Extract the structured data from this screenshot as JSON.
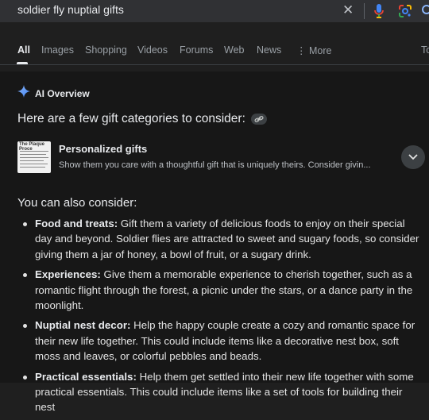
{
  "search": {
    "query": "soldier fly nuptial gifts",
    "clear_glyph": "✕"
  },
  "tabs": [
    {
      "label": "All",
      "active": true
    },
    {
      "label": "Images"
    },
    {
      "label": "Shopping"
    },
    {
      "label": "Videos"
    },
    {
      "label": "Forums"
    },
    {
      "label": "Web"
    },
    {
      "label": "News"
    },
    {
      "label": "⋮ More"
    },
    {
      "label": "To"
    }
  ],
  "ai_overview": {
    "header": "AI Overview",
    "intro": "Here are a few gift categories to consider:",
    "gift_card": {
      "thumb_text": "The Plaque Proce",
      "title": "Personalized gifts",
      "description": "Show them you care with a thoughtful gift that is uniquely theirs. Consider givin..."
    },
    "also_heading": "You can also consider:",
    "items": [
      {
        "title": "Food and treats:",
        "text": " Gift them a variety of delicious foods to enjoy on their special day and beyond. Soldier flies are attracted to sweet and sugary foods, so consider giving them a jar of honey, a bowl of fruit, or a sugary drink."
      },
      {
        "title": "Experiences:",
        "text": " Give them a memorable experience to cherish together, such as a romantic flight through the forest, a picnic under the stars, or a dance party in the moonlight."
      },
      {
        "title": "Nuptial nest decor:",
        "text": " Help the happy couple create a cozy and romantic space for their new life together. This could include items like a decorative nest box, soft moss and leaves, or colorful pebbles and beads."
      },
      {
        "title": "Practical essentials:",
        "text": " Help them get settled into their new life together with some practical essentials. This could include items like a set of tools for building their nest"
      }
    ]
  },
  "colors": {
    "background": "#1f1f1f",
    "card": "#171717",
    "text": "#e3e3e3",
    "muted": "#9aa0a6",
    "accent_blue": "#8ab4f8"
  },
  "icons": [
    "clear-icon",
    "microphone-icon",
    "google-lens-icon",
    "search-icon",
    "gemini-sparkle-icon",
    "link-icon",
    "chevron-down-icon"
  ]
}
